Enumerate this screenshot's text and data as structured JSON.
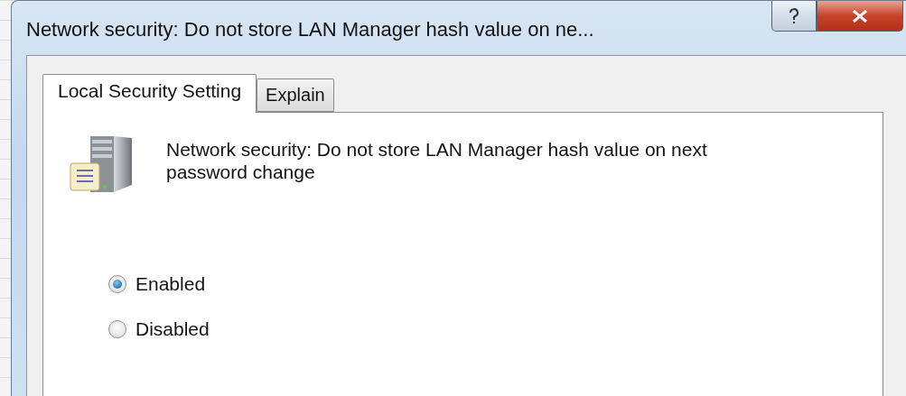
{
  "window": {
    "title": "Network security: Do not store LAN Manager hash value on ne..."
  },
  "tabs": [
    {
      "label": "Local Security Setting",
      "selected": true
    },
    {
      "label": "Explain",
      "selected": false
    }
  ],
  "policy": {
    "description": "Network security: Do not store LAN Manager hash value on next password change"
  },
  "options": [
    {
      "label": "Enabled",
      "selected": true
    },
    {
      "label": "Disabled",
      "selected": false
    }
  ]
}
